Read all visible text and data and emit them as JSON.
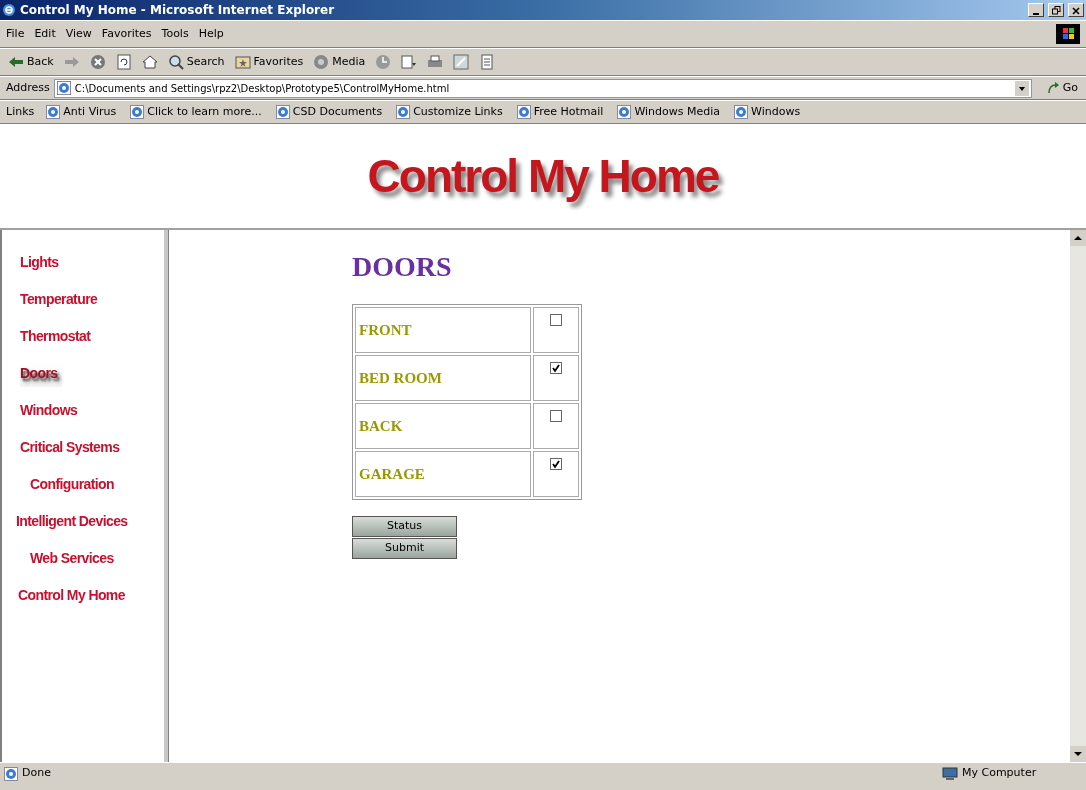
{
  "window": {
    "title": "Control My Home - Microsoft Internet Explorer"
  },
  "menu": [
    "File",
    "Edit",
    "View",
    "Favorites",
    "Tools",
    "Help"
  ],
  "toolbar": [
    {
      "kind": "back",
      "label": "Back"
    },
    {
      "kind": "forward"
    },
    {
      "kind": "stop"
    },
    {
      "kind": "refresh"
    },
    {
      "kind": "home"
    },
    {
      "kind": "search",
      "label": "Search"
    },
    {
      "kind": "favorites",
      "label": "Favorites"
    },
    {
      "kind": "media",
      "label": "Media"
    },
    {
      "kind": "history"
    },
    {
      "kind": "mail"
    },
    {
      "kind": "print"
    },
    {
      "kind": "edit"
    },
    {
      "kind": "discuss"
    }
  ],
  "address": {
    "label": "Address",
    "value": "C:\\Documents and Settings\\rpz2\\Desktop\\Prototype5\\ControlMyHome.html",
    "go": "Go"
  },
  "links": {
    "label": "Links",
    "items": [
      "Anti Virus",
      "Click to learn more...",
      "CSD Documents",
      "Customize Links",
      "Free Hotmail",
      "Windows Media",
      "Windows"
    ]
  },
  "page": {
    "banner": "Control My Home",
    "nav": [
      {
        "label": "Lights",
        "selected": false
      },
      {
        "label": "Temperature",
        "selected": false
      },
      {
        "label": "Thermostat",
        "selected": false
      },
      {
        "label": "Doors",
        "selected": true
      },
      {
        "label": "Windows",
        "selected": false
      },
      {
        "label": "Critical Systems",
        "selected": false
      },
      {
        "label": "Configuration",
        "selected": false
      },
      {
        "label": "Intelligent Devices",
        "selected": false
      },
      {
        "label": "Web Services",
        "selected": false
      },
      {
        "label": "Control My Home",
        "selected": false
      }
    ],
    "heading": "DOORS",
    "doors": [
      {
        "label": "FRONT",
        "checked": false
      },
      {
        "label": "BED ROOM",
        "checked": true
      },
      {
        "label": "BACK",
        "checked": false
      },
      {
        "label": "GARAGE",
        "checked": true
      }
    ],
    "buttons": [
      "Status",
      "Submit"
    ]
  },
  "status_bar": {
    "text": "Done",
    "zone": "My Computer"
  }
}
